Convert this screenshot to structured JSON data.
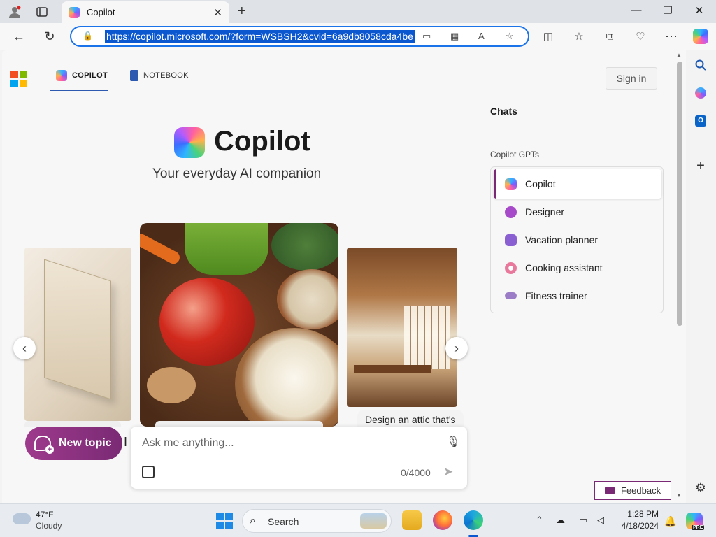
{
  "browser": {
    "tab_title": "Copilot",
    "url": "https://copilot.microsoft.com/?form=WSBSH2&cvid=6a9db8058cda4be",
    "icons": [
      "profile-icon",
      "tab-actions-icon",
      "back-icon",
      "refresh-icon",
      "lock-icon",
      "app-available-icon",
      "grid-icon",
      "read-aloud-icon",
      "favorite-star-icon",
      "split-screen-icon",
      "favorites-icon",
      "collections-icon",
      "browser-essentials-icon",
      "more-icon",
      "copilot-icon"
    ]
  },
  "header": {
    "tabs": [
      {
        "label": "COPILOT",
        "active": true
      },
      {
        "label": "NOTEBOOK",
        "active": false
      }
    ],
    "sign_in": "Sign in"
  },
  "hero": {
    "title": "Copilot",
    "subtitle": "Your everyday AI companion"
  },
  "carousel": {
    "cards": [
      {
        "image": "book-image",
        "caption": ""
      },
      {
        "image": "food-image",
        "caption": ""
      },
      {
        "image": "attic-image",
        "caption": "Design an attic that's"
      }
    ]
  },
  "composer": {
    "new_topic": "New topic",
    "placeholder": "Ask me anything...",
    "char_count": "0/4000"
  },
  "sidebar": {
    "chats_title": "Chats",
    "gpts_title": "Copilot GPTs",
    "gpts": [
      {
        "label": "Copilot",
        "color": "#6d6df2",
        "active": true
      },
      {
        "label": "Designer",
        "color": "#a64ac9",
        "active": false
      },
      {
        "label": "Vacation planner",
        "color": "#8a5fd1",
        "active": false
      },
      {
        "label": "Cooking assistant",
        "color": "#e8789c",
        "active": false
      },
      {
        "label": "Fitness trainer",
        "color": "#9a7cc7",
        "active": false
      }
    ]
  },
  "feedback": "Feedback",
  "taskbar": {
    "weather_temp": "47°F",
    "weather_condition": "Cloudy",
    "search_label": "Search",
    "time": "1:28 PM",
    "date": "4/18/2024",
    "copilot_badge": "PRE"
  },
  "colors": {
    "accent": "#7a2a74",
    "link_blue": "#0b57d0",
    "ms_red": "#f25022",
    "ms_green": "#7fba00",
    "ms_blue": "#00a4ef",
    "ms_yellow": "#ffb900"
  }
}
